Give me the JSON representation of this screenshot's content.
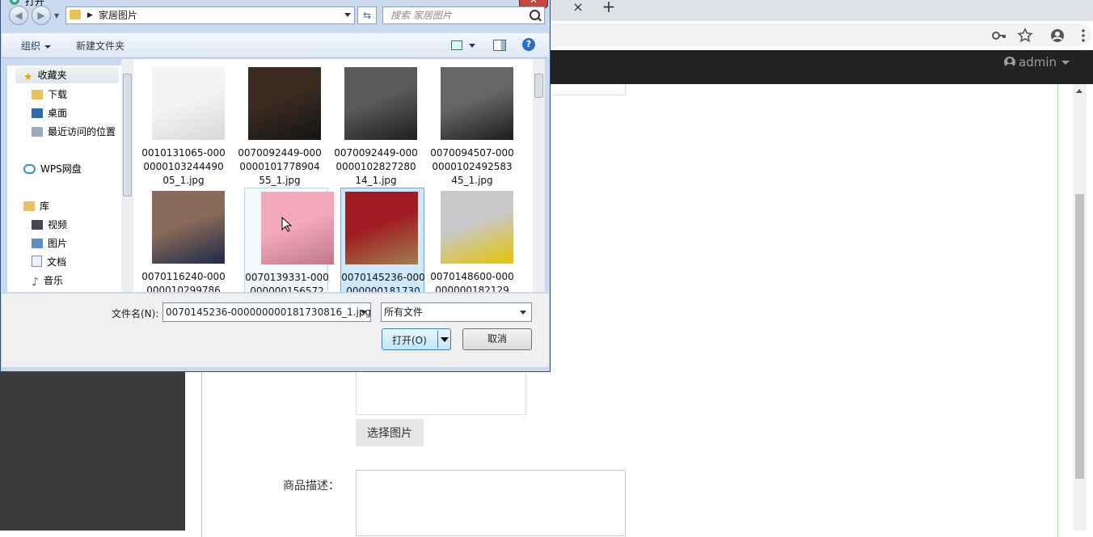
{
  "browser": {
    "close_tab_glyph": "×",
    "new_tab_glyph": "+",
    "icons": [
      "key-icon",
      "star-icon",
      "profile-icon",
      "menu-icon"
    ]
  },
  "navbar": {
    "user": "admin"
  },
  "form": {
    "pick_image_button": "选择图片",
    "description_label": "商品描述："
  },
  "dialog": {
    "title": "打开",
    "close_glyph": "✕",
    "path": "家居图片",
    "search_placeholder": "搜索 家居图片",
    "toolbar": {
      "organize": "组织",
      "new_folder": "新建文件夹"
    },
    "nav": {
      "favorites": "收藏夹",
      "downloads": "下载",
      "desktop": "桌面",
      "recent": "最近访问的位置",
      "wps": "WPS网盘",
      "library": "库",
      "videos": "视频",
      "pictures": "图片",
      "documents": "文档",
      "music": "音乐"
    },
    "files": [
      {
        "name": "0010131065-000000010324449005_1.jpg",
        "colors": [
          "#f4f4f4",
          "#d8d8d8"
        ]
      },
      {
        "name": "0070092449-000000010177890455_1.jpg",
        "colors": [
          "#3a2a20",
          "#151515"
        ]
      },
      {
        "name": "0070092449-000000010282728014_1.jpg",
        "colors": [
          "#5a5a5a",
          "#1f1f1f"
        ]
      },
      {
        "name": "0070094507-000000010249258345_1.jpg",
        "colors": [
          "#666666",
          "#1d1d1d"
        ]
      },
      {
        "name": "0070116240-000000010299786",
        "colors": [
          "#8a6a5a",
          "#1d2a4a"
        ]
      },
      {
        "name": "0070139331-000000000156572",
        "colors": [
          "#f3a9b9",
          "#c07888"
        ]
      },
      {
        "name": "0070145236-000000000181730",
        "colors": [
          "#a01c22",
          "#a08050"
        ]
      },
      {
        "name": "0070148600-000000000182129",
        "colors": [
          "#c8c8c8",
          "#e5c400"
        ]
      }
    ],
    "filename_label": "文件名(N):",
    "filename_value": "0070145236-000000000181730816_1.jpg",
    "file_type": "所有文件",
    "open_button": "打开(O)",
    "cancel_button": "取消"
  }
}
